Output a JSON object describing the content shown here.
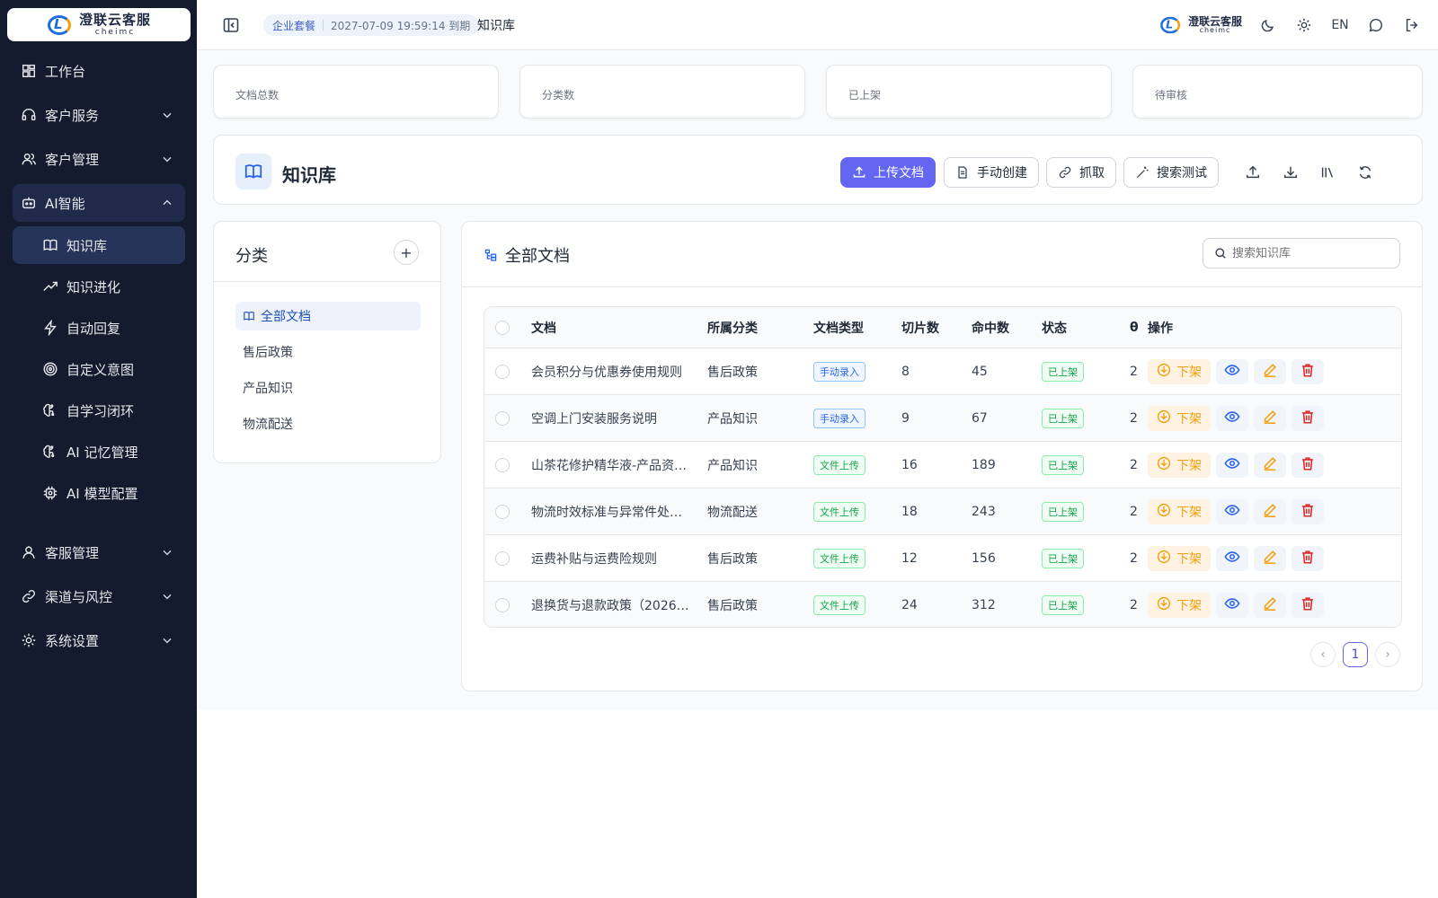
{
  "brand": {
    "logo_cn": "澄联云客服",
    "logo_en": "cheimc"
  },
  "sidebar": {
    "items": [
      {
        "label": "工作台",
        "icon": "dashboard-icon",
        "has_chevron": false
      },
      {
        "label": "客户服务",
        "icon": "headset-icon",
        "has_chevron": true
      },
      {
        "label": "客户管理",
        "icon": "users-icon",
        "has_chevron": true
      },
      {
        "label": "AI智能",
        "icon": "bot-icon",
        "has_chevron": true,
        "expanded": true
      },
      {
        "label": "客服管理",
        "icon": "user-icon",
        "has_chevron": true
      },
      {
        "label": "渠道与风控",
        "icon": "link-icon",
        "has_chevron": true
      },
      {
        "label": "系统设置",
        "icon": "gear-icon",
        "has_chevron": true
      }
    ],
    "ai_sub_items": [
      {
        "label": "知识库",
        "icon": "book-icon",
        "active": true
      },
      {
        "label": "知识进化",
        "icon": "trend-up-icon"
      },
      {
        "label": "自动回复",
        "icon": "bolt-icon"
      },
      {
        "label": "自定义意图",
        "icon": "target-icon"
      },
      {
        "label": "自学习闭环",
        "icon": "brain-icon"
      },
      {
        "label": "AI 记忆管理",
        "icon": "brain-icon"
      },
      {
        "label": "AI 模型配置",
        "icon": "chip-icon"
      }
    ]
  },
  "topbar": {
    "plan": "企业套餐",
    "expire": "2027-07-09 19:59:14 到期",
    "breadcrumb": "知识库",
    "lang": "EN"
  },
  "stats": [
    "文档总数",
    "分类数",
    "已上架",
    "待审核"
  ],
  "kb": {
    "title": "知识库",
    "upload": "上传文档",
    "manual_create": "手动创建",
    "crawl": "抓取",
    "search_test": "搜索测试"
  },
  "categories": {
    "title": "分类",
    "add": "+",
    "items": [
      "全部文档",
      "售后政策",
      "产品知识",
      "物流配送"
    ]
  },
  "docs": {
    "title": "全部文档",
    "search_placeholder": "搜索知识库",
    "columns": [
      "文档",
      "所属分类",
      "文档类型",
      "切片数",
      "命中数",
      "状态",
      "θ",
      "操作"
    ],
    "rows": [
      {
        "name": "会员积分与优惠券使用规则",
        "category": "售后政策",
        "type": "手动录入",
        "type_kind": "manual",
        "chunks": "8",
        "hits": "45",
        "status": "已上架",
        "v": "2",
        "off": "下架"
      },
      {
        "name": "空调上门安装服务说明",
        "category": "产品知识",
        "type": "手动录入",
        "type_kind": "manual",
        "chunks": "9",
        "hits": "67",
        "status": "已上架",
        "v": "2",
        "off": "下架"
      },
      {
        "name": "山茶花修护精华液-产品资…",
        "category": "产品知识",
        "type": "文件上传",
        "type_kind": "file",
        "chunks": "16",
        "hits": "189",
        "status": "已上架",
        "v": "2",
        "off": "下架"
      },
      {
        "name": "物流时效标准与异常件处…",
        "category": "物流配送",
        "type": "文件上传",
        "type_kind": "file",
        "chunks": "18",
        "hits": "243",
        "status": "已上架",
        "v": "2",
        "off": "下架"
      },
      {
        "name": "运费补贴与运费险规则",
        "category": "售后政策",
        "type": "文件上传",
        "type_kind": "file",
        "chunks": "12",
        "hits": "156",
        "status": "已上架",
        "v": "2",
        "off": "下架"
      },
      {
        "name": "退换货与退款政策（2026…",
        "category": "售后政策",
        "type": "文件上传",
        "type_kind": "file",
        "chunks": "24",
        "hits": "312",
        "status": "已上架",
        "v": "2",
        "off": "下架"
      }
    ],
    "page": "1"
  },
  "colors": {
    "sidebar_bg": "#141b2e",
    "primary": "#6366f1",
    "warn": "#f59e0b",
    "danger": "#dc2626",
    "info": "#2563eb"
  }
}
